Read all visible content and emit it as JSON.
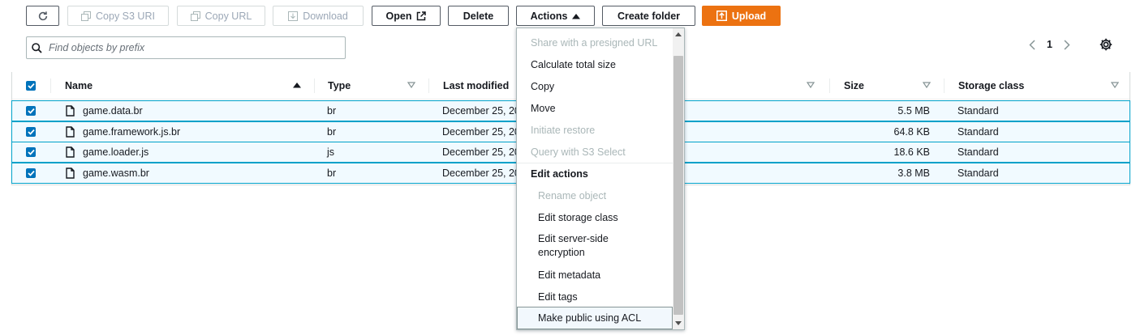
{
  "toolbar": {
    "copy_s3_uri": "Copy S3 URI",
    "copy_url": "Copy URL",
    "download": "Download",
    "open": "Open",
    "delete": "Delete",
    "actions": "Actions",
    "create_folder": "Create folder",
    "upload": "Upload"
  },
  "search": {
    "placeholder": "Find objects by prefix"
  },
  "pagination": {
    "current_page": "1"
  },
  "table": {
    "headers": {
      "name": "Name",
      "type": "Type",
      "last_modified": "Last modified",
      "size": "Size",
      "storage_class": "Storage class"
    },
    "rows": [
      {
        "name": "game.data.br",
        "type": "br",
        "last_modified": "December 25, 20",
        "size": "5.5 MB",
        "storage_class": "Standard"
      },
      {
        "name": "game.framework.js.br",
        "type": "br",
        "last_modified": "December 25, 20",
        "size": "64.8 KB",
        "storage_class": "Standard"
      },
      {
        "name": "game.loader.js",
        "type": "js",
        "last_modified": "December 25, 20",
        "size": "18.6 KB",
        "storage_class": "Standard"
      },
      {
        "name": "game.wasm.br",
        "type": "br",
        "last_modified": "December 25, 20",
        "size": "3.8 MB",
        "storage_class": "Standard"
      }
    ]
  },
  "actions_menu": {
    "items": [
      {
        "label": "Share with a presigned URL",
        "disabled": true
      },
      {
        "label": "Calculate total size",
        "disabled": false
      },
      {
        "label": "Copy",
        "disabled": false
      },
      {
        "label": "Move",
        "disabled": false
      },
      {
        "label": "Initiate restore",
        "disabled": true
      },
      {
        "label": "Query with S3 Select",
        "disabled": true
      }
    ],
    "group_label": "Edit actions",
    "edit_items": [
      {
        "label": "Rename object",
        "disabled": true
      },
      {
        "label": "Edit storage class",
        "disabled": false
      },
      {
        "label": "Edit server-side",
        "label2": "encryption",
        "disabled": false
      },
      {
        "label": "Edit metadata",
        "disabled": false
      },
      {
        "label": "Edit tags",
        "disabled": false
      },
      {
        "label": "Make public using ACL",
        "disabled": false,
        "highlighted": true
      }
    ]
  },
  "colors": {
    "accent": "#0073bb",
    "primary_button": "#ec7211",
    "selected_row_bg": "#f1faff",
    "selected_row_border": "#00a1c9"
  }
}
